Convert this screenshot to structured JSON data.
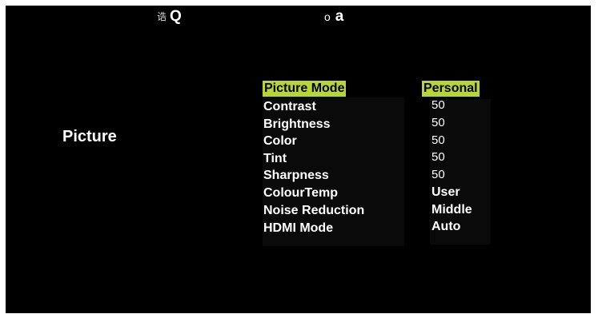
{
  "top_bar": {
    "left_glyph": "诰",
    "left_letter": "Q",
    "right_glyph": "o",
    "right_letter": "a"
  },
  "section_title": "Picture",
  "colors": {
    "highlight": "#b9d531",
    "background": "#000000",
    "text": "#ffffff"
  },
  "menu": {
    "selected_index": 0,
    "items": [
      {
        "label": "Picture Mode",
        "value": "Personal"
      },
      {
        "label": "Contrast",
        "value": "50"
      },
      {
        "label": "Brightness",
        "value": "50"
      },
      {
        "label": "Color",
        "value": "50"
      },
      {
        "label": "Tint",
        "value": "50"
      },
      {
        "label": "Sharpness",
        "value": "50"
      },
      {
        "label": "ColourTemp",
        "value": "User"
      },
      {
        "label": "Noise Reduction",
        "value": "Middle"
      },
      {
        "label": "HDMI Mode",
        "value": "Auto"
      }
    ]
  }
}
